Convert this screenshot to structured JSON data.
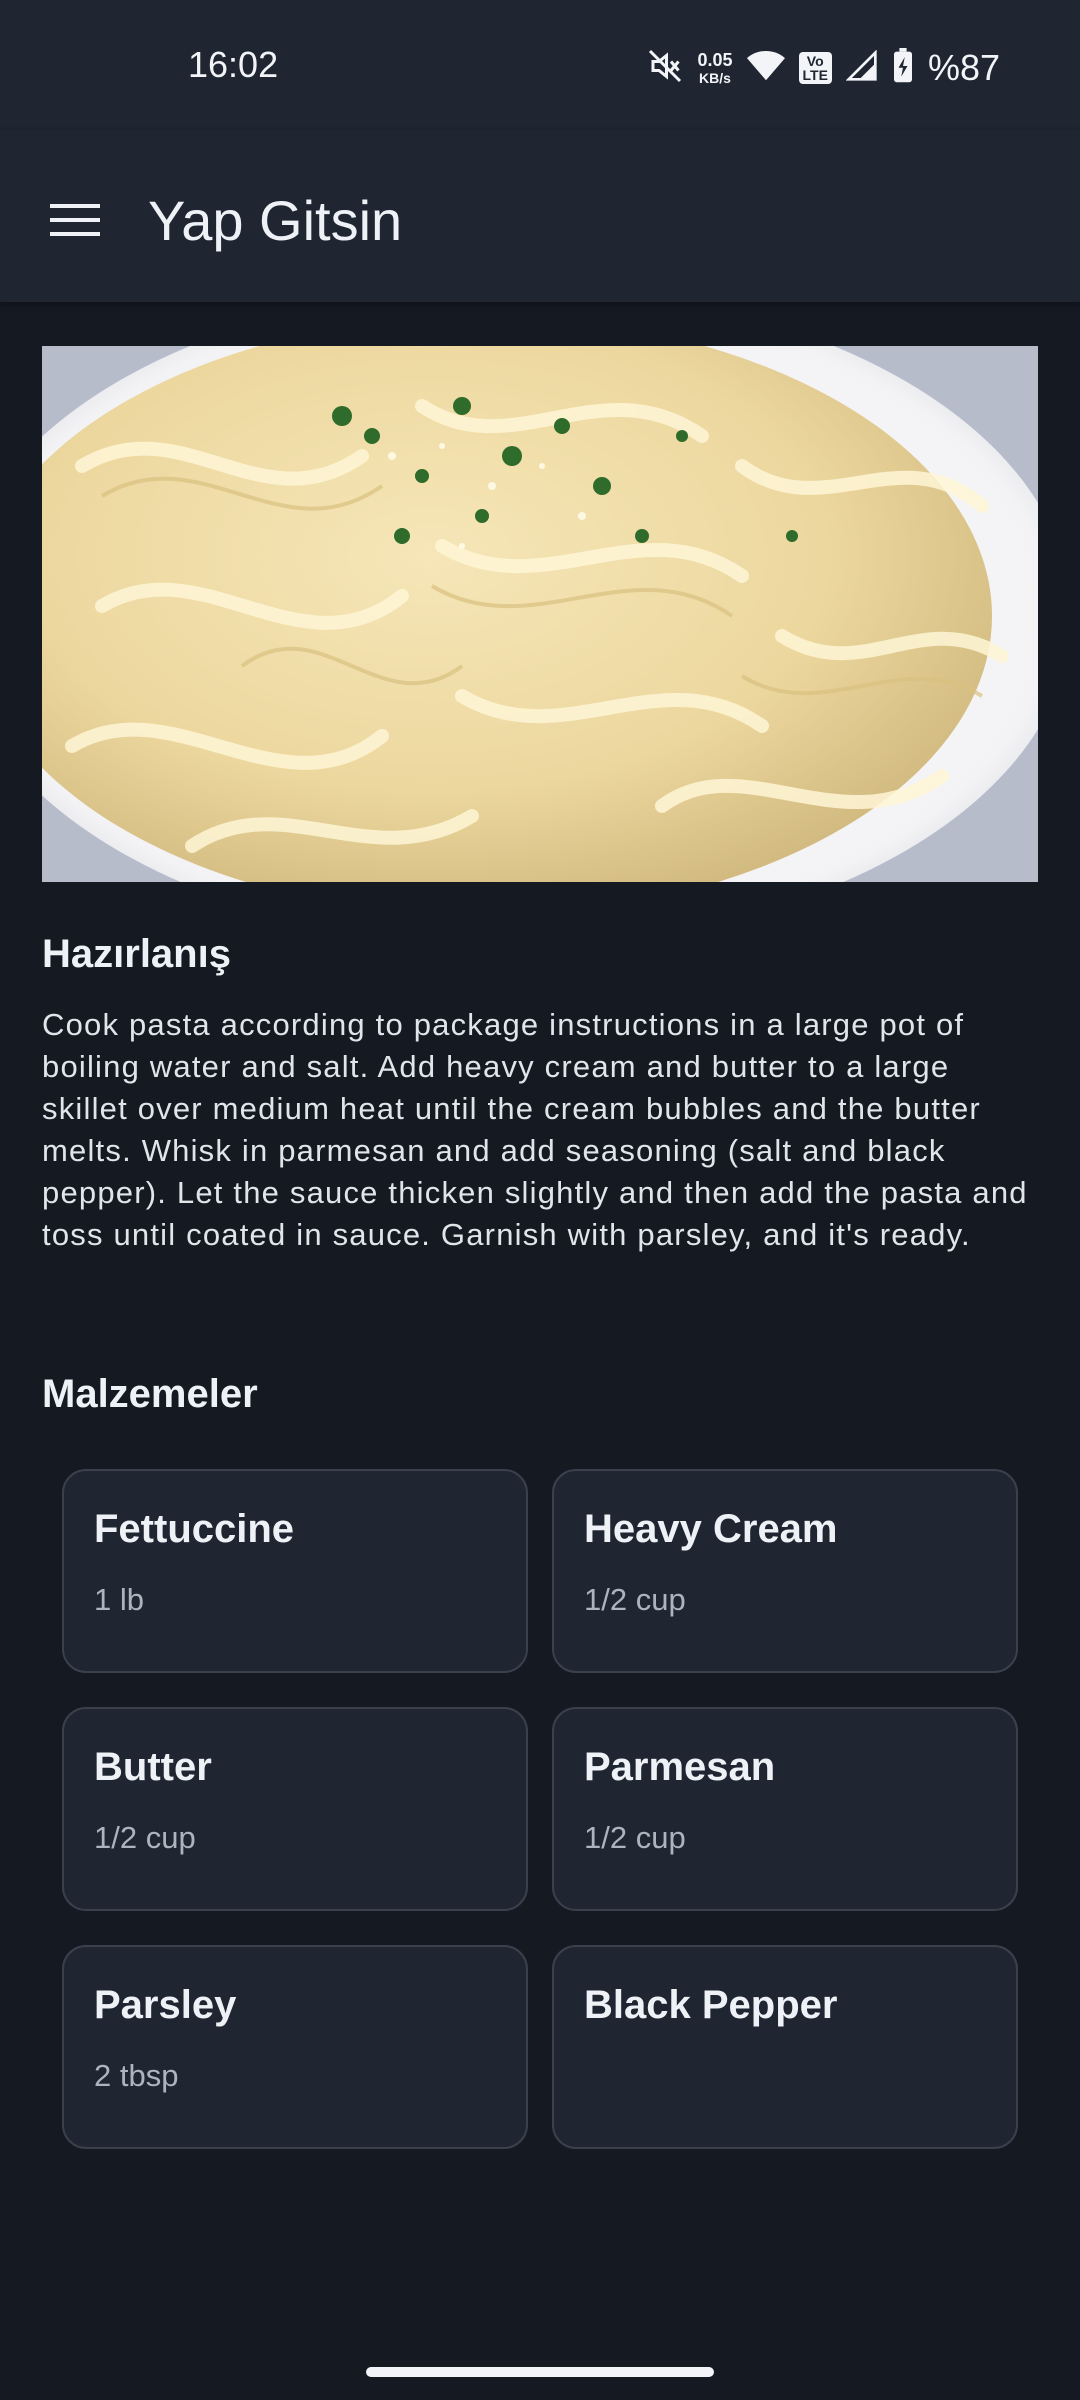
{
  "status_bar": {
    "time": "16:02",
    "net_speed_value": "0.05",
    "net_speed_unit": "KB/s",
    "volte_top": "Vo",
    "volte_bottom": "LTE",
    "battery": "%87"
  },
  "app_bar": {
    "title": "Yap Gitsin",
    "menu_icon": "hamburger-menu-icon"
  },
  "recipe": {
    "image": "fettuccine-alfredo-photo",
    "preparation_title": "Hazırlanış",
    "preparation_text": "Cook pasta according to package instructions in a large pot of boiling water and salt. Add heavy cream and butter to a large skillet over medium heat until the cream bubbles and the butter melts. Whisk in parmesan and add seasoning (salt and black pepper). Let the sauce thicken slightly and then add the pasta and toss until coated in sauce. Garnish with parsley, and it's ready.",
    "ingredients_title": "Malzemeler",
    "ingredients": [
      {
        "name": "Fettuccine",
        "qty": "1 lb"
      },
      {
        "name": "Heavy Cream",
        "qty": "1/2 cup"
      },
      {
        "name": "Butter",
        "qty": "1/2 cup"
      },
      {
        "name": "Parmesan",
        "qty": "1/2 cup"
      },
      {
        "name": "Parsley",
        "qty": "2 tbsp"
      },
      {
        "name": "Black Pepper",
        "qty": ""
      }
    ]
  },
  "colors": {
    "background": "#141922",
    "app_bar": "#1f2632",
    "card": "#1f2632",
    "card_border": "#3a414d",
    "text_primary": "#eef1f5",
    "text_secondary": "#aeb4bd"
  }
}
